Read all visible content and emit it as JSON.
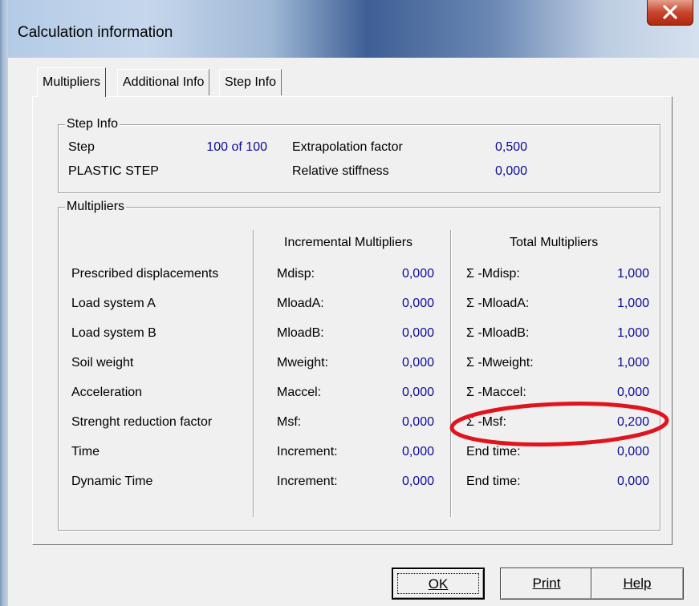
{
  "window": {
    "title": "Calculation information"
  },
  "tabs": [
    {
      "label": "Multipliers",
      "active": true
    },
    {
      "label": "Additional Info",
      "active": false
    },
    {
      "label": "Step Info",
      "active": false
    }
  ],
  "step_info": {
    "group_label": "Step Info",
    "step_label": "Step",
    "step_value": "100 of 100",
    "phase_label": "PLASTIC STEP",
    "extrapolation_label": "Extrapolation factor",
    "extrapolation_value": "0,500",
    "stiffness_label": "Relative stiffness",
    "stiffness_value": "0,000"
  },
  "multipliers": {
    "group_label": "Multipliers",
    "incremental_header": "Incremental Multipliers",
    "total_header": "Total Multipliers",
    "rows": [
      {
        "label": "Prescribed displacements",
        "inc_label": "Mdisp:",
        "inc_value": "0,000",
        "tot_label": "Σ -Mdisp:",
        "tot_value": "1,000"
      },
      {
        "label": "Load system A",
        "inc_label": "MloadA:",
        "inc_value": "0,000",
        "tot_label": "Σ -MloadA:",
        "tot_value": "1,000"
      },
      {
        "label": "Load system B",
        "inc_label": "MloadB:",
        "inc_value": "0,000",
        "tot_label": "Σ -MloadB:",
        "tot_value": "1,000"
      },
      {
        "label": "Soil weight",
        "inc_label": "Mweight:",
        "inc_value": "0,000",
        "tot_label": "Σ -Mweight:",
        "tot_value": "1,000"
      },
      {
        "label": "Acceleration",
        "inc_label": "Maccel:",
        "inc_value": "0,000",
        "tot_label": "Σ -Maccel:",
        "tot_value": "0,000"
      },
      {
        "label": "Strenght reduction factor",
        "inc_label": "Msf:",
        "inc_value": "0,000",
        "tot_label": "Σ -Msf:",
        "tot_value": "0,200"
      },
      {
        "label": "Time",
        "inc_label": "Increment:",
        "inc_value": "0,000",
        "tot_label": "End time:",
        "tot_value": "0,000"
      },
      {
        "label": "Dynamic Time",
        "inc_label": "Increment:",
        "inc_value": "0,000",
        "tot_label": "End time:",
        "tot_value": "0,000"
      }
    ]
  },
  "buttons": {
    "ok": "OK",
    "print": "Print",
    "help": "Help"
  },
  "colors": {
    "value_text": "#0b0b96",
    "highlight_ellipse": "#e0141e"
  }
}
